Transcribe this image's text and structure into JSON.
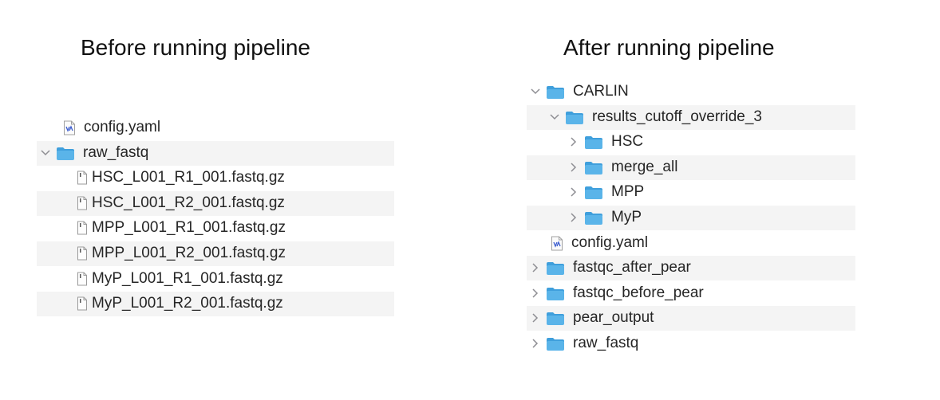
{
  "left_panel": {
    "title": "Before running pipeline",
    "items": [
      {
        "name": "config.yaml",
        "kind": "yaml-file-icon",
        "level": 1,
        "chevron": "none",
        "striped": false
      },
      {
        "name": "raw_fastq",
        "kind": "folder-icon",
        "level": 0,
        "chevron": "down",
        "striped": true
      },
      {
        "name": "HSC_L001_R1_001.fastq.gz",
        "kind": "file-icon",
        "level": 2,
        "chevron": "none",
        "striped": false
      },
      {
        "name": "HSC_L001_R2_001.fastq.gz",
        "kind": "file-icon",
        "level": 2,
        "chevron": "none",
        "striped": true
      },
      {
        "name": "MPP_L001_R1_001.fastq.gz",
        "kind": "file-icon",
        "level": 2,
        "chevron": "none",
        "striped": false
      },
      {
        "name": "MPP_L001_R2_001.fastq.gz",
        "kind": "file-icon",
        "level": 2,
        "chevron": "none",
        "striped": true
      },
      {
        "name": "MyP_L001_R1_001.fastq.gz",
        "kind": "file-icon",
        "level": 2,
        "chevron": "none",
        "striped": false
      },
      {
        "name": "MyP_L001_R2_001.fastq.gz",
        "kind": "file-icon",
        "level": 2,
        "chevron": "none",
        "striped": true
      }
    ]
  },
  "right_panel": {
    "title": "After running pipeline",
    "items": [
      {
        "name": "CARLIN",
        "kind": "folder-icon",
        "level": 0,
        "chevron": "down",
        "striped": false
      },
      {
        "name": "results_cutoff_override_3",
        "kind": "folder-icon",
        "level": 1,
        "chevron": "down",
        "striped": true
      },
      {
        "name": "HSC",
        "kind": "folder-icon",
        "level": 2,
        "chevron": "right",
        "striped": false
      },
      {
        "name": "merge_all",
        "kind": "folder-icon",
        "level": 2,
        "chevron": "right",
        "striped": true
      },
      {
        "name": "MPP",
        "kind": "folder-icon",
        "level": 2,
        "chevron": "right",
        "striped": false
      },
      {
        "name": "MyP",
        "kind": "folder-icon",
        "level": 2,
        "chevron": "right",
        "striped": true
      },
      {
        "name": "config.yaml",
        "kind": "yaml-file-icon",
        "level": 1,
        "chevron": "none",
        "striped": false
      },
      {
        "name": "fastqc_after_pear",
        "kind": "folder-icon",
        "level": 0,
        "chevron": "right",
        "striped": true
      },
      {
        "name": "fastqc_before_pear",
        "kind": "folder-icon",
        "level": 0,
        "chevron": "right",
        "striped": false
      },
      {
        "name": "pear_output",
        "kind": "folder-icon",
        "level": 0,
        "chevron": "right",
        "striped": true
      },
      {
        "name": "raw_fastq",
        "kind": "folder-icon",
        "level": 0,
        "chevron": "right",
        "striped": false
      }
    ]
  },
  "colors": {
    "folder": "#5ab4e9",
    "folder_tab": "#3f9fdc",
    "stripe": "#f4f4f4",
    "chevron": "#8e8e93"
  }
}
